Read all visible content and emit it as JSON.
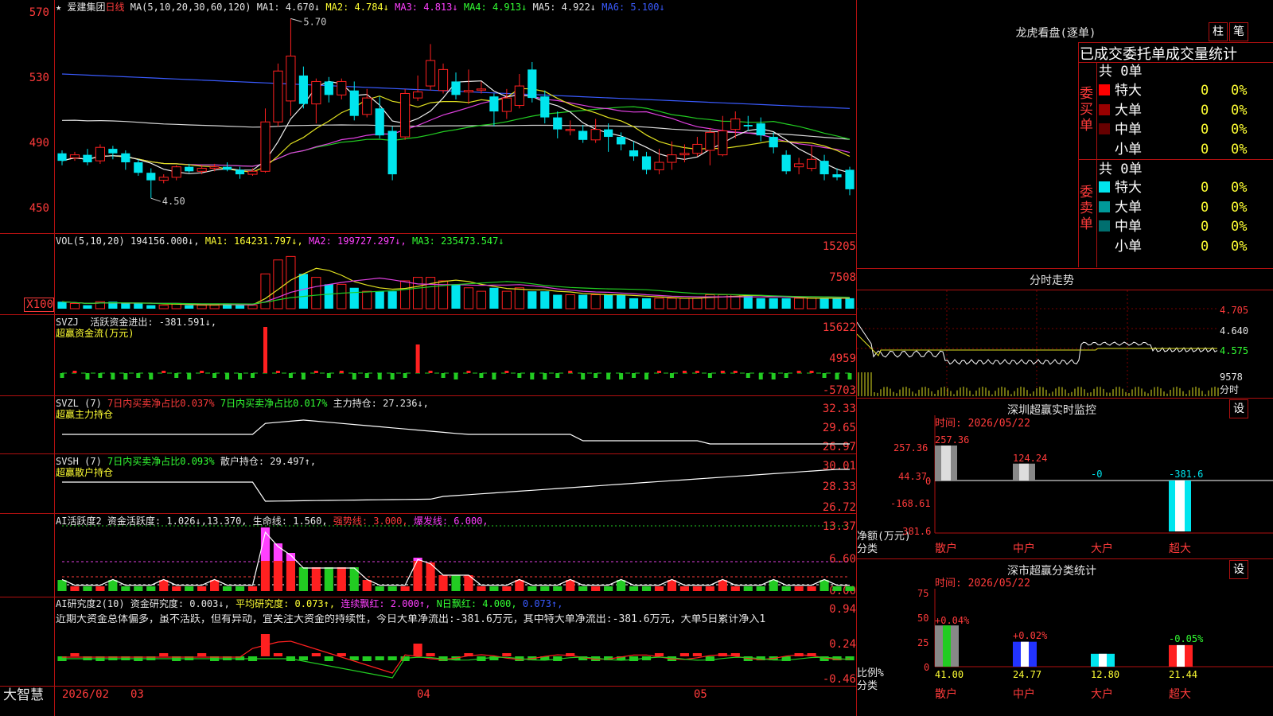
{
  "stock": {
    "star": "★",
    "name": "爱建集团",
    "period": "日线"
  },
  "ma_legend": {
    "prefix": "MA(5,10,20,30,60,120)",
    "items": [
      {
        "label": "MA1: 4.670↓",
        "color": "#e6e6e6"
      },
      {
        "label": "MA2: 4.784↓",
        "color": "#ffff33"
      },
      {
        "label": "MA3: 4.813↓",
        "color": "#ff40ff"
      },
      {
        "label": "MA4: 4.913↓",
        "color": "#33ff33"
      },
      {
        "label": "MA5: 4.922↓",
        "color": "#e6e6e6"
      },
      {
        "label": "MA6: 5.100↓",
        "color": "#3a5bff"
      }
    ]
  },
  "price_axis": [
    "570",
    "530",
    "490",
    "450"
  ],
  "annotations": {
    "high": "5.70",
    "low": "4.50"
  },
  "vol": {
    "prefix": "VOL(5,10,20)",
    "value": "194156.000↓,",
    "ma1": "MA1: 164231.797↓,",
    "ma2": "MA2: 199727.297↓,",
    "ma3": "MA3: 235473.547↓",
    "axis": [
      "15205",
      "7508",
      "X100"
    ]
  },
  "svzj": {
    "prefix": "SVZJ",
    "label": "活跃资金进出: -381.591↓,",
    "subtitle": "超赢资金流(万元)",
    "axis": [
      "15622",
      "4959",
      "-5703"
    ]
  },
  "svzl": {
    "prefix": "SVZL (7)",
    "a": "7日内买卖净占比0.037%",
    "b": "7日内买卖净占比0.017%",
    "c": "主力持仓: 27.236↓,",
    "subtitle": "超赢主力持仓",
    "axis": [
      "32.33",
      "29.65",
      "26.97"
    ]
  },
  "svsh": {
    "prefix": "SVSH (7)",
    "a": "7日内买卖净占比0.093%",
    "c": "散户持仓: 29.497↑,",
    "subtitle": "超赢散户持仓",
    "axis": [
      "30.01",
      "28.33",
      "26.72"
    ]
  },
  "ai1": {
    "prefix": "AI活跃度2",
    "a": "资金活跃度: 1.026↓,13.370,",
    "b": "生命线: 1.560,",
    "c": "强势线: 3.000,",
    "d": "爆发线: 6.000,",
    "axis": [
      "13.37",
      "6.60",
      "0.00"
    ]
  },
  "ai2": {
    "prefix": "AI研究度2(10)",
    "a": "资金研究度: 0.003↓,",
    "b": "平均研究度: 0.073↑,",
    "c": "连续飘红: 2.000↑,",
    "d": "N日飘红: 4.000,",
    "e": "0.073↑,",
    "axis": [
      "0.94",
      "0.24",
      "-0.46"
    ],
    "comment": "近期大资金总体偏多，虽不活跃，但有异动，宜关注大资金的持续性，今日大单净流出:-381.6万元，其中特大单净流出:-381.6万元，大单5日累计净入1"
  },
  "dates": {
    "brand": "大智慧",
    "d1": "2026/02",
    "d2": "03",
    "d3": "04",
    "d4": "05"
  },
  "longhu": {
    "title": "龙虎看盘(逐单)",
    "btn1": "柱",
    "btn2": "笔",
    "header": "已成交委托单成交量统计",
    "buy_side": "委买单",
    "sell_side": "委卖单",
    "buy_total": "共 0单",
    "sell_total": "共 0单",
    "buy_rows": [
      {
        "name": "特大",
        "n": "0",
        "p": "0%",
        "color": "#ff0000"
      },
      {
        "name": "大单",
        "n": "0",
        "p": "0%",
        "color": "#990000"
      },
      {
        "name": "中单",
        "n": "0",
        "p": "0%",
        "color": "#660000"
      },
      {
        "name": "小单",
        "n": "0",
        "p": "0%",
        "color": "#000000"
      }
    ],
    "sell_rows": [
      {
        "name": "特大",
        "n": "0",
        "p": "0%",
        "color": "#00e5ee"
      },
      {
        "name": "大单",
        "n": "0",
        "p": "0%",
        "color": "#009999"
      },
      {
        "name": "中单",
        "n": "0",
        "p": "0%",
        "color": "#006f6f"
      },
      {
        "name": "小单",
        "n": "0",
        "p": "0%",
        "color": "#000000"
      }
    ]
  },
  "intraday": {
    "title": "分时走势",
    "axis": [
      "4.705",
      "4.640",
      "4.575",
      "9578",
      "分时"
    ]
  },
  "sz_monitor": {
    "title": "深圳超赢实时监控",
    "btn": "设",
    "time": "时间: 2026/05/22",
    "axis": [
      "257.36",
      "44.37",
      "0",
      "-168.61",
      "-381.6"
    ],
    "ylabel1": "净额(万元)",
    "ylabel2": "分类",
    "cats": [
      "散户",
      "中户",
      "大户",
      "超大"
    ],
    "values": [
      "257.36",
      "124.24",
      "-0",
      "-381.6"
    ]
  },
  "sz_stats": {
    "title": "深市超赢分类统计",
    "btn": "设",
    "time": "时间: 2026/05/22",
    "axis": [
      "75",
      "50",
      "25",
      "0"
    ],
    "ylabel1": "比例%",
    "ylabel2": "分类",
    "cats": [
      "散户",
      "中户",
      "大户",
      "超大"
    ],
    "changes": [
      "+0.04%",
      "+0.02%",
      "",
      "-0.05%"
    ],
    "values": [
      "41.00",
      "24.77",
      "12.80",
      "21.44"
    ]
  },
  "chart_data": {
    "type": "candlestick",
    "price_ylim": [
      4.4,
      5.75
    ],
    "candles": [
      [
        4.8,
        4.75,
        4.82,
        4.72
      ],
      [
        4.77,
        4.79,
        4.81,
        4.75
      ],
      [
        4.79,
        4.74,
        4.83,
        4.72
      ],
      [
        4.75,
        4.84,
        4.86,
        4.73
      ],
      [
        4.83,
        4.8,
        4.85,
        4.76
      ],
      [
        4.8,
        4.74,
        4.82,
        4.69
      ],
      [
        4.74,
        4.67,
        4.76,
        4.65
      ],
      [
        4.67,
        4.62,
        4.7,
        4.5
      ],
      [
        4.62,
        4.64,
        4.66,
        4.6
      ],
      [
        4.64,
        4.71,
        4.72,
        4.62
      ],
      [
        4.71,
        4.68,
        4.73,
        4.67
      ],
      [
        4.68,
        4.7,
        4.72,
        4.66
      ],
      [
        4.7,
        4.71,
        4.73,
        4.68
      ],
      [
        4.71,
        4.69,
        4.74,
        4.68
      ],
      [
        4.69,
        4.66,
        4.71,
        4.63
      ],
      [
        4.66,
        4.68,
        4.7,
        4.65
      ],
      [
        4.68,
        5.01,
        5.1,
        4.67
      ],
      [
        5.01,
        5.35,
        5.4,
        4.98
      ],
      [
        5.15,
        5.45,
        5.7,
        5.05
      ],
      [
        5.32,
        5.13,
        5.38,
        5.1
      ],
      [
        5.13,
        5.28,
        5.3,
        5.0
      ],
      [
        5.28,
        5.19,
        5.31,
        5.14
      ],
      [
        5.19,
        5.28,
        5.3,
        5.16
      ],
      [
        5.22,
        5.05,
        5.28,
        5.02
      ],
      [
        5.06,
        5.17,
        5.23,
        5.04
      ],
      [
        5.1,
        4.92,
        5.18,
        4.9
      ],
      [
        4.95,
        4.66,
        4.98,
        4.62
      ],
      [
        4.91,
        5.2,
        5.23,
        4.89
      ],
      [
        5.17,
        5.21,
        5.32,
        5.15
      ],
      [
        5.25,
        5.42,
        5.53,
        5.22
      ],
      [
        5.22,
        5.36,
        5.4,
        5.2
      ],
      [
        5.28,
        5.19,
        5.34,
        5.16
      ],
      [
        5.21,
        5.22,
        5.36,
        5.13
      ],
      [
        5.23,
        5.23,
        5.28,
        5.2
      ],
      [
        5.18,
        5.08,
        5.2,
        4.98
      ],
      [
        5.08,
        5.17,
        5.23,
        5.03
      ],
      [
        5.12,
        5.25,
        5.33,
        5.1
      ],
      [
        5.36,
        5.17,
        5.41,
        5.14
      ],
      [
        5.18,
        5.04,
        5.22,
        5.0
      ],
      [
        5.04,
        4.96,
        5.08,
        4.9
      ],
      [
        4.96,
        4.96,
        5.02,
        4.92
      ],
      [
        4.95,
        4.89,
        4.99,
        4.87
      ],
      [
        4.89,
        4.96,
        5.03,
        4.87
      ],
      [
        4.96,
        4.91,
        5.0,
        4.81
      ],
      [
        4.91,
        4.86,
        4.94,
        4.82
      ],
      [
        4.82,
        4.78,
        4.88,
        4.75
      ],
      [
        4.78,
        4.69,
        4.81,
        4.66
      ],
      [
        4.69,
        4.74,
        4.83,
        4.66
      ],
      [
        4.74,
        4.79,
        4.88,
        4.69
      ],
      [
        4.79,
        4.8,
        4.86,
        4.74
      ],
      [
        4.8,
        4.86,
        4.91,
        4.78
      ],
      [
        4.82,
        4.94,
        4.97,
        4.72
      ],
      [
        4.79,
        4.95,
        5.05,
        4.78
      ],
      [
        4.96,
        5.03,
        5.08,
        4.9
      ],
      [
        4.99,
        4.98,
        5.05,
        4.95
      ],
      [
        5.0,
        4.92,
        5.04,
        4.88
      ],
      [
        4.91,
        4.84,
        4.94,
        4.8
      ],
      [
        4.79,
        4.68,
        4.82,
        4.66
      ],
      [
        4.71,
        4.73,
        4.77,
        4.66
      ],
      [
        4.7,
        4.76,
        4.85,
        4.68
      ],
      [
        4.75,
        4.66,
        4.79,
        4.62
      ],
      [
        4.66,
        4.64,
        4.7,
        4.62
      ],
      [
        4.69,
        4.56,
        4.71,
        4.52
      ]
    ],
    "volume": [
      2,
      1.5,
      1,
      2,
      2,
      1.5,
      1.5,
      1,
      1,
      1.5,
      1,
      1,
      1,
      1.5,
      1,
      1,
      10,
      14,
      15,
      10,
      9,
      7,
      7,
      6,
      5,
      5,
      5,
      8,
      9,
      9,
      8,
      7,
      6,
      5,
      6,
      5,
      6,
      5,
      5,
      4,
      4,
      4,
      4,
      4,
      4,
      3,
      3,
      3,
      3,
      3,
      3,
      4,
      4,
      4,
      4,
      3,
      3,
      3,
      3,
      3,
      3,
      3,
      3
    ],
    "ma_lines": {
      "ma_120_start": 5.33,
      "ma_120_end": 5.1
    }
  }
}
